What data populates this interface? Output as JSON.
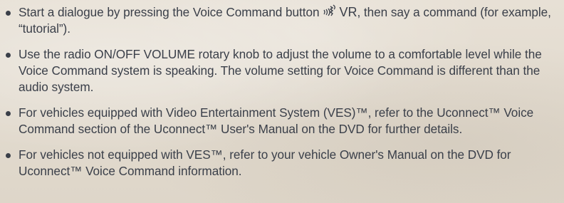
{
  "tips": [
    {
      "before_icon": "Start a dialogue by pressing the Voice Command button",
      "icon": "voice-command-icon",
      "button_label": "VR",
      "after_icon": ", then say a command (for example, “tutorial”)."
    },
    {
      "text": "Use the radio ON/OFF VOLUME rotary knob to adjust the volume to a comfortable level while the Voice Command system is speaking. The volume setting for Voice Command is different than the audio system."
    },
    {
      "text": "For vehicles equipped with Video Entertainment System (VES)™, refer to the Uconnect™ Voice Command section of the Uconnect™ User's Manual on the DVD for further details."
    },
    {
      "text": "For vehicles not equipped with VES™, refer to your vehicle Owner's Manual on the DVD for Uconnect™ Voice Command information."
    }
  ]
}
